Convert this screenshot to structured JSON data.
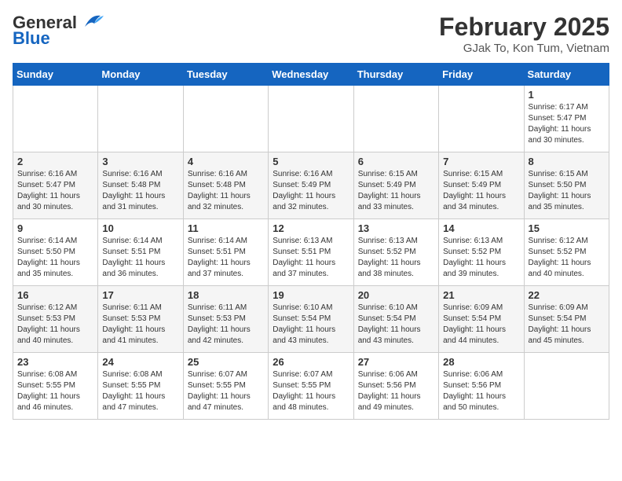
{
  "header": {
    "logo_general": "General",
    "logo_blue": "Blue",
    "title": "February 2025",
    "location": "GJak To, Kon Tum, Vietnam"
  },
  "days_of_week": [
    "Sunday",
    "Monday",
    "Tuesday",
    "Wednesday",
    "Thursday",
    "Friday",
    "Saturday"
  ],
  "weeks": [
    [
      {
        "day": "",
        "info": ""
      },
      {
        "day": "",
        "info": ""
      },
      {
        "day": "",
        "info": ""
      },
      {
        "day": "",
        "info": ""
      },
      {
        "day": "",
        "info": ""
      },
      {
        "day": "",
        "info": ""
      },
      {
        "day": "1",
        "info": "Sunrise: 6:17 AM\nSunset: 5:47 PM\nDaylight: 11 hours and 30 minutes."
      }
    ],
    [
      {
        "day": "2",
        "info": "Sunrise: 6:16 AM\nSunset: 5:47 PM\nDaylight: 11 hours and 30 minutes."
      },
      {
        "day": "3",
        "info": "Sunrise: 6:16 AM\nSunset: 5:48 PM\nDaylight: 11 hours and 31 minutes."
      },
      {
        "day": "4",
        "info": "Sunrise: 6:16 AM\nSunset: 5:48 PM\nDaylight: 11 hours and 32 minutes."
      },
      {
        "day": "5",
        "info": "Sunrise: 6:16 AM\nSunset: 5:49 PM\nDaylight: 11 hours and 32 minutes."
      },
      {
        "day": "6",
        "info": "Sunrise: 6:15 AM\nSunset: 5:49 PM\nDaylight: 11 hours and 33 minutes."
      },
      {
        "day": "7",
        "info": "Sunrise: 6:15 AM\nSunset: 5:49 PM\nDaylight: 11 hours and 34 minutes."
      },
      {
        "day": "8",
        "info": "Sunrise: 6:15 AM\nSunset: 5:50 PM\nDaylight: 11 hours and 35 minutes."
      }
    ],
    [
      {
        "day": "9",
        "info": "Sunrise: 6:14 AM\nSunset: 5:50 PM\nDaylight: 11 hours and 35 minutes."
      },
      {
        "day": "10",
        "info": "Sunrise: 6:14 AM\nSunset: 5:51 PM\nDaylight: 11 hours and 36 minutes."
      },
      {
        "day": "11",
        "info": "Sunrise: 6:14 AM\nSunset: 5:51 PM\nDaylight: 11 hours and 37 minutes."
      },
      {
        "day": "12",
        "info": "Sunrise: 6:13 AM\nSunset: 5:51 PM\nDaylight: 11 hours and 37 minutes."
      },
      {
        "day": "13",
        "info": "Sunrise: 6:13 AM\nSunset: 5:52 PM\nDaylight: 11 hours and 38 minutes."
      },
      {
        "day": "14",
        "info": "Sunrise: 6:13 AM\nSunset: 5:52 PM\nDaylight: 11 hours and 39 minutes."
      },
      {
        "day": "15",
        "info": "Sunrise: 6:12 AM\nSunset: 5:52 PM\nDaylight: 11 hours and 40 minutes."
      }
    ],
    [
      {
        "day": "16",
        "info": "Sunrise: 6:12 AM\nSunset: 5:53 PM\nDaylight: 11 hours and 40 minutes."
      },
      {
        "day": "17",
        "info": "Sunrise: 6:11 AM\nSunset: 5:53 PM\nDaylight: 11 hours and 41 minutes."
      },
      {
        "day": "18",
        "info": "Sunrise: 6:11 AM\nSunset: 5:53 PM\nDaylight: 11 hours and 42 minutes."
      },
      {
        "day": "19",
        "info": "Sunrise: 6:10 AM\nSunset: 5:54 PM\nDaylight: 11 hours and 43 minutes."
      },
      {
        "day": "20",
        "info": "Sunrise: 6:10 AM\nSunset: 5:54 PM\nDaylight: 11 hours and 43 minutes."
      },
      {
        "day": "21",
        "info": "Sunrise: 6:09 AM\nSunset: 5:54 PM\nDaylight: 11 hours and 44 minutes."
      },
      {
        "day": "22",
        "info": "Sunrise: 6:09 AM\nSunset: 5:54 PM\nDaylight: 11 hours and 45 minutes."
      }
    ],
    [
      {
        "day": "23",
        "info": "Sunrise: 6:08 AM\nSunset: 5:55 PM\nDaylight: 11 hours and 46 minutes."
      },
      {
        "day": "24",
        "info": "Sunrise: 6:08 AM\nSunset: 5:55 PM\nDaylight: 11 hours and 47 minutes."
      },
      {
        "day": "25",
        "info": "Sunrise: 6:07 AM\nSunset: 5:55 PM\nDaylight: 11 hours and 47 minutes."
      },
      {
        "day": "26",
        "info": "Sunrise: 6:07 AM\nSunset: 5:55 PM\nDaylight: 11 hours and 48 minutes."
      },
      {
        "day": "27",
        "info": "Sunrise: 6:06 AM\nSunset: 5:56 PM\nDaylight: 11 hours and 49 minutes."
      },
      {
        "day": "28",
        "info": "Sunrise: 6:06 AM\nSunset: 5:56 PM\nDaylight: 11 hours and 50 minutes."
      },
      {
        "day": "",
        "info": ""
      }
    ]
  ]
}
